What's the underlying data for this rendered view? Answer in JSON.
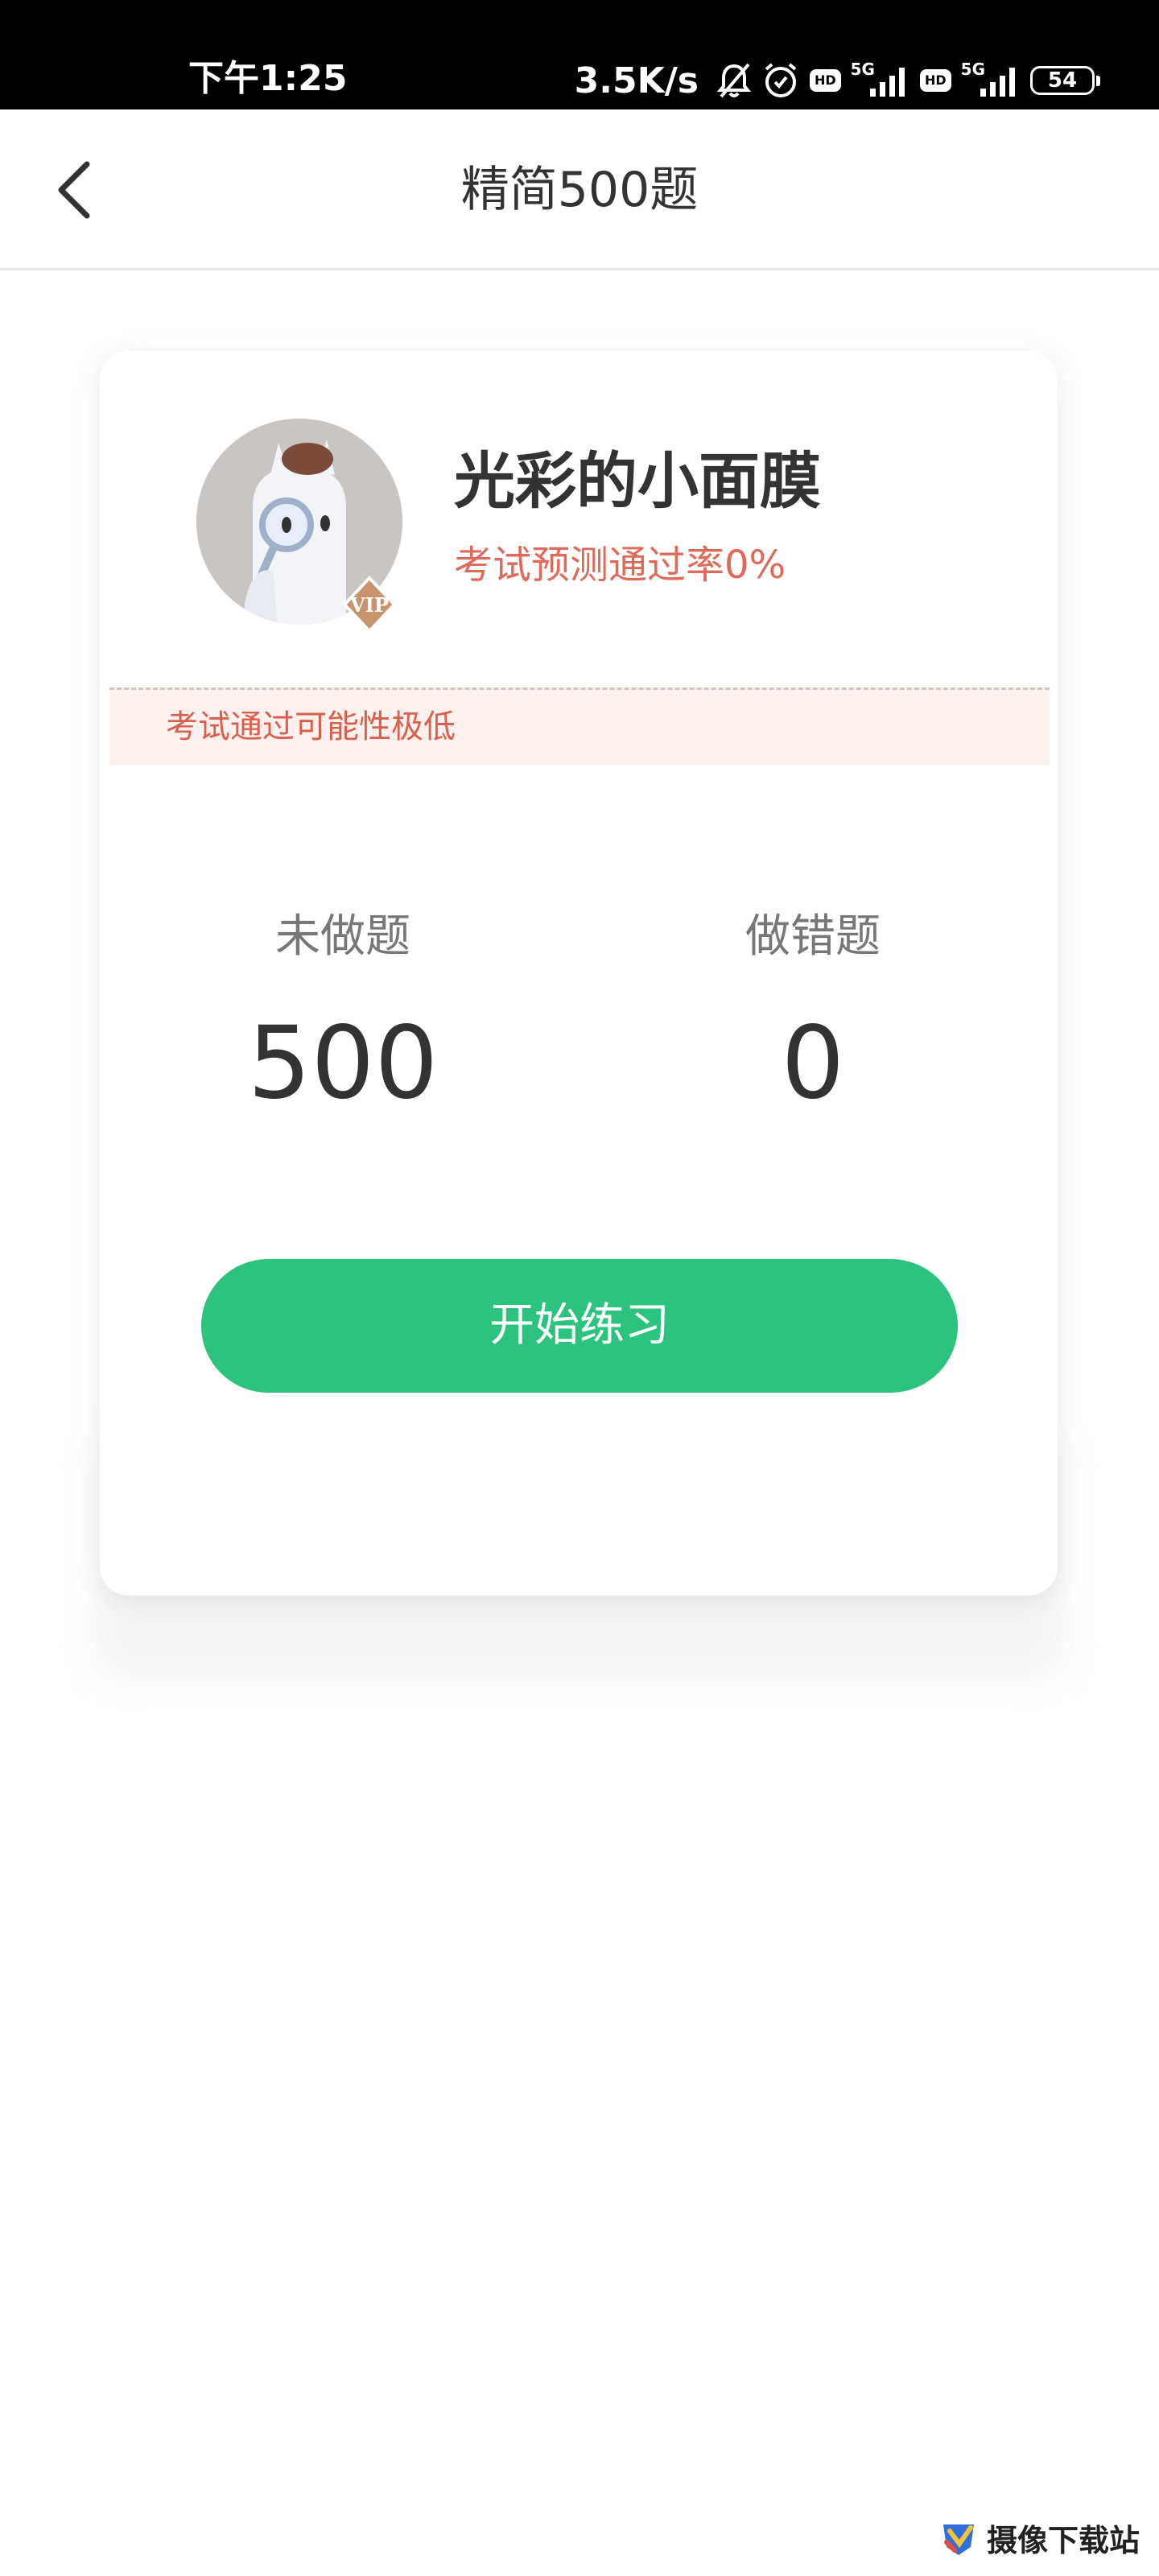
{
  "status_bar": {
    "time": "下午1:25",
    "net_speed": "3.5K/s",
    "hd_label": "HD",
    "network_label": "5G",
    "battery": "54",
    "icons": [
      "bell-muted-icon",
      "alarm-icon",
      "hd-icon",
      "signal-icon",
      "hd-icon",
      "signal-icon",
      "battery-icon"
    ]
  },
  "nav": {
    "title": "精简500题",
    "back_icon": "chevron-left-icon"
  },
  "profile": {
    "name": "光彩的小面膜",
    "pass_rate": "考试预测通过率0%",
    "vip_badge_text": "VIP"
  },
  "warning": {
    "text": "考试通过可能性极低"
  },
  "stats": {
    "undone_label": "未做题",
    "undone_value": "500",
    "wrong_label": "做错题",
    "wrong_value": "0"
  },
  "actions": {
    "start_label": "开始练习"
  },
  "watermark": {
    "text": "摄像下载站"
  },
  "colors": {
    "accent_green": "#2bc37d",
    "warning_red": "#e06a5a",
    "warning_bg": "#fdf1ee"
  }
}
